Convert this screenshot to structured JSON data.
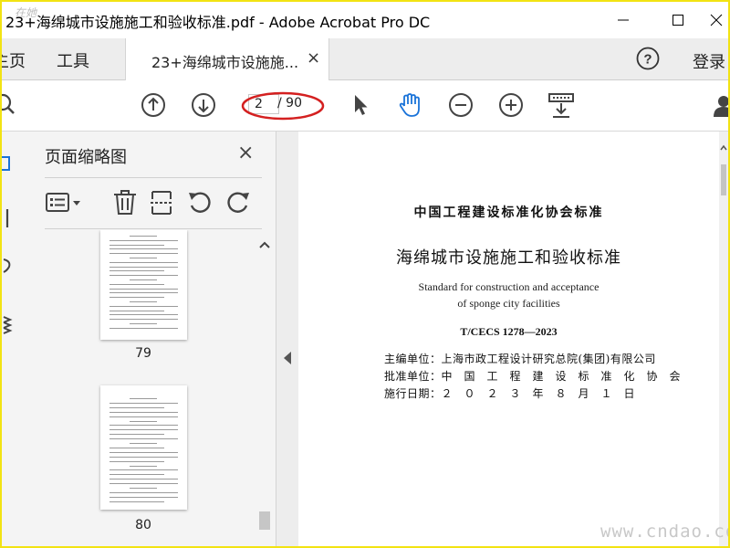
{
  "window": {
    "title": "23+海绵城市设施施工和验收标准.pdf - Adobe Acrobat Pro DC",
    "minimize_icon": "minimize-icon",
    "maximize_icon": "maximize-icon",
    "close_icon": "close-icon"
  },
  "tabs": {
    "home": "主页",
    "tools": "工具",
    "document": "23+海绵城市设施施...",
    "close_glyph": "×",
    "help_glyph": "?",
    "login": "登录"
  },
  "toolbar": {
    "current_page": "2",
    "total_pages": "/ 90",
    "highlight_color": "#d42020",
    "active_tool_color": "#1a73d9"
  },
  "thumbnail_panel": {
    "title": "页面缩略图",
    "close_glyph": "×",
    "thumbnails": [
      {
        "page_number": "79"
      },
      {
        "page_number": "80"
      }
    ]
  },
  "document": {
    "org_line": "中国工程建设标准化协会标准",
    "title": "海绵城市设施施工和验收标准",
    "english_line1": "Standard for construction and acceptance",
    "english_line2": "of sponge city facilities",
    "code": "T/CECS 1278—2023",
    "chief_editor": "主编单位：上海市政工程设计研究总院(集团)有限公司",
    "approval": "批准单位：中　国　工　程　建　设　标　准　化　协　会",
    "effective_date": "施行日期：２　０　２　３　年　８　月　１　日"
  },
  "watermarks": {
    "top_left": "在她",
    "bottom_right": "www.cndao.com"
  }
}
